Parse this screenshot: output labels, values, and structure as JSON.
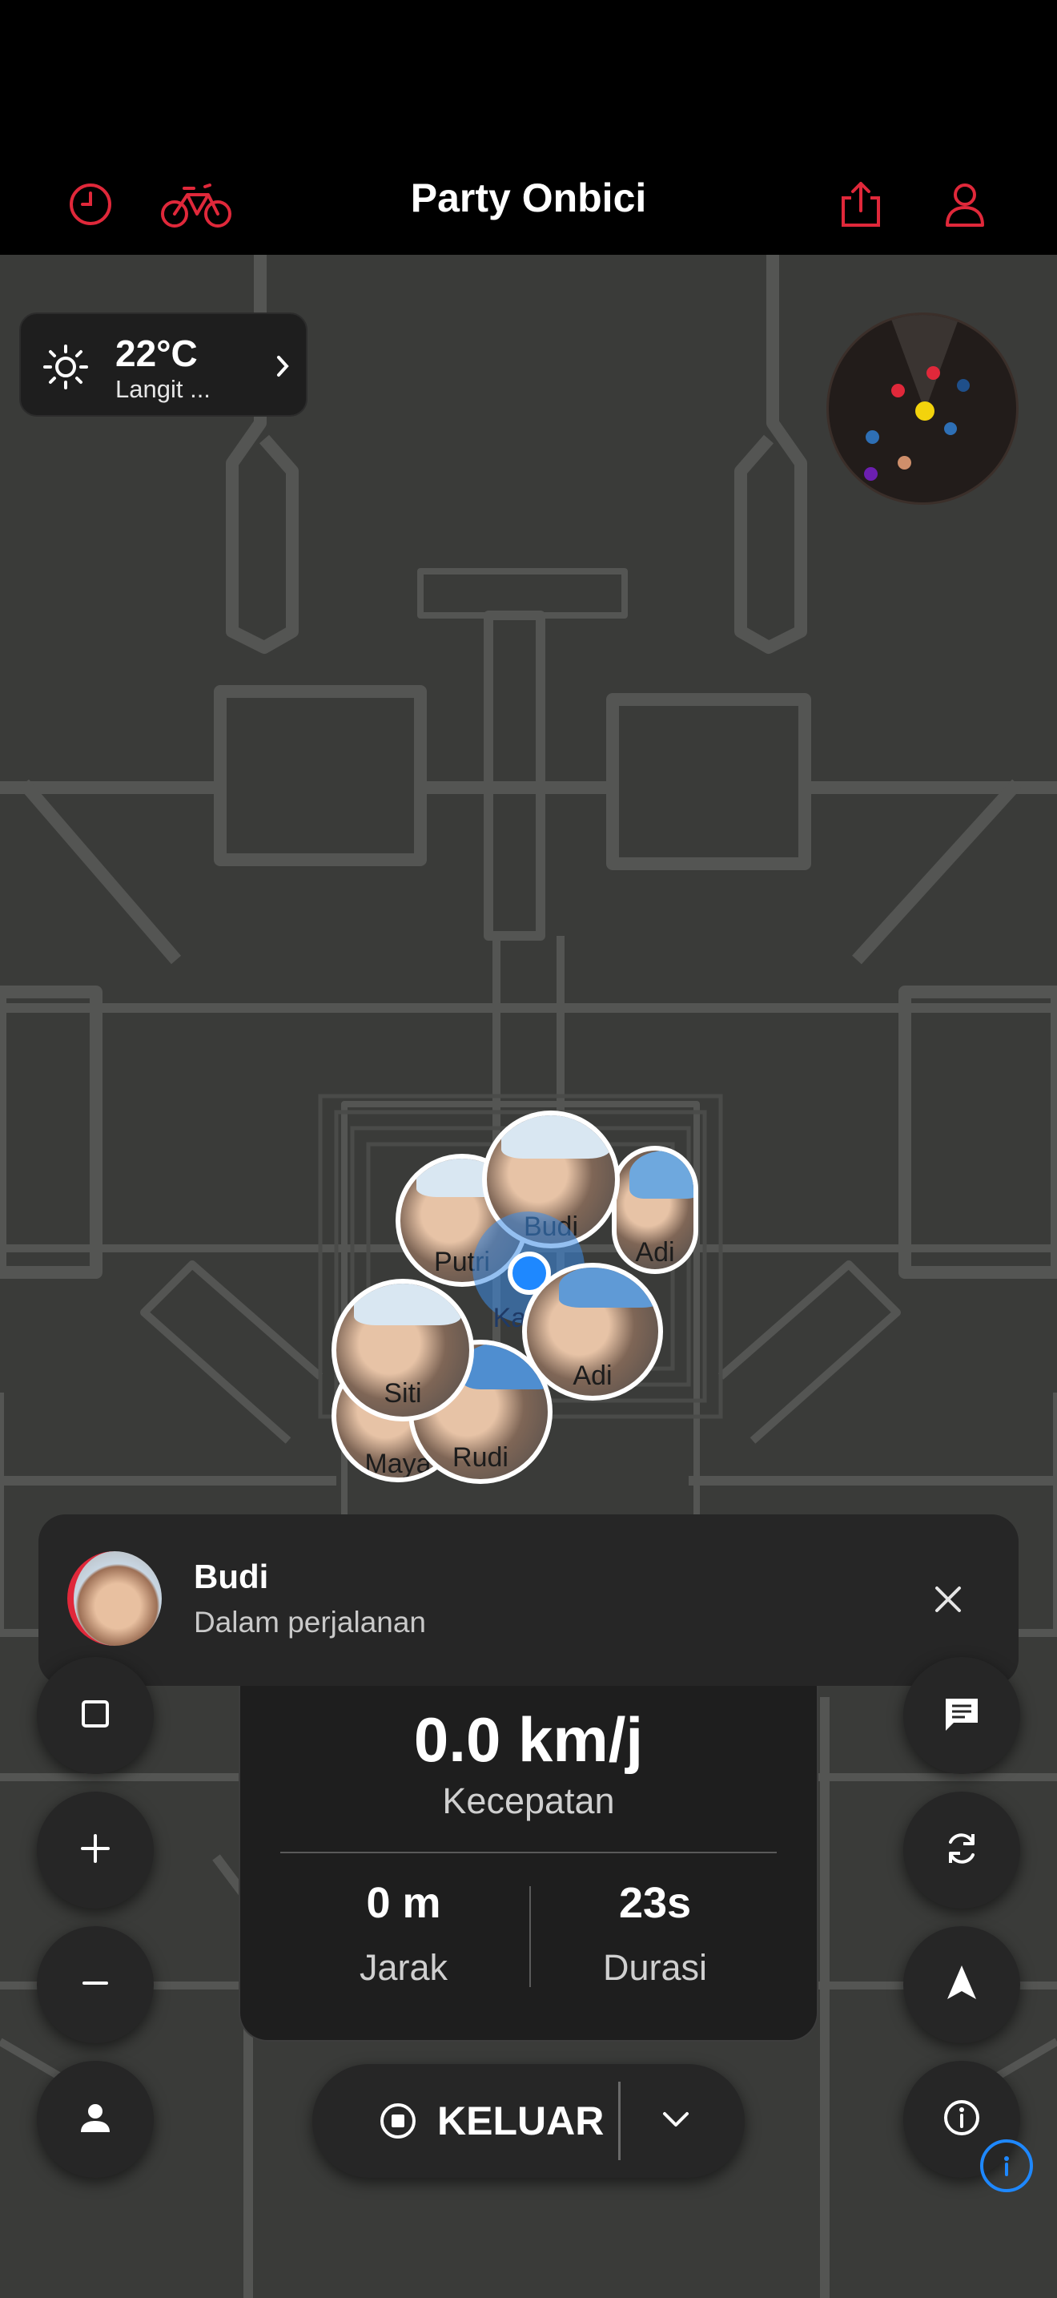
{
  "app": {
    "title": "Party Onbici"
  },
  "colors": {
    "accent": "#e0283a",
    "self": "#1e88ff",
    "panel": "#262626",
    "map_bg": "#3a3b39"
  },
  "top_bar": {
    "left_icons": [
      "history-icon",
      "bicycle-icon"
    ],
    "right_icons": [
      "share-icon",
      "profile-icon"
    ]
  },
  "weather": {
    "temperature": "22°C",
    "condition": "Langit ...",
    "icon": "sun-icon"
  },
  "map": {
    "riders": [
      {
        "name": "Budi"
      },
      {
        "name": "Adi"
      },
      {
        "name": "Putri"
      },
      {
        "name": "Adi"
      },
      {
        "name": "Siti"
      },
      {
        "name": "Rudi"
      },
      {
        "name": "Maya"
      }
    ],
    "self_label": "Kamu"
  },
  "notification": {
    "name": "Budi",
    "status": "Dalam perjalanan"
  },
  "stats": {
    "speed": "0.0 km/j",
    "speed_label": "Kecepatan",
    "distance": "0 m",
    "distance_label": "Jarak",
    "duration": "23s",
    "duration_label": "Durasi"
  },
  "controls": {
    "left": [
      "stop-square-icon",
      "zoom-in-icon",
      "zoom-out-icon",
      "person-icon"
    ],
    "right": [
      "chat-icon",
      "sync-icon",
      "navigation-arrow-icon",
      "info-icon"
    ]
  },
  "exit": {
    "label": "KELUAR"
  }
}
